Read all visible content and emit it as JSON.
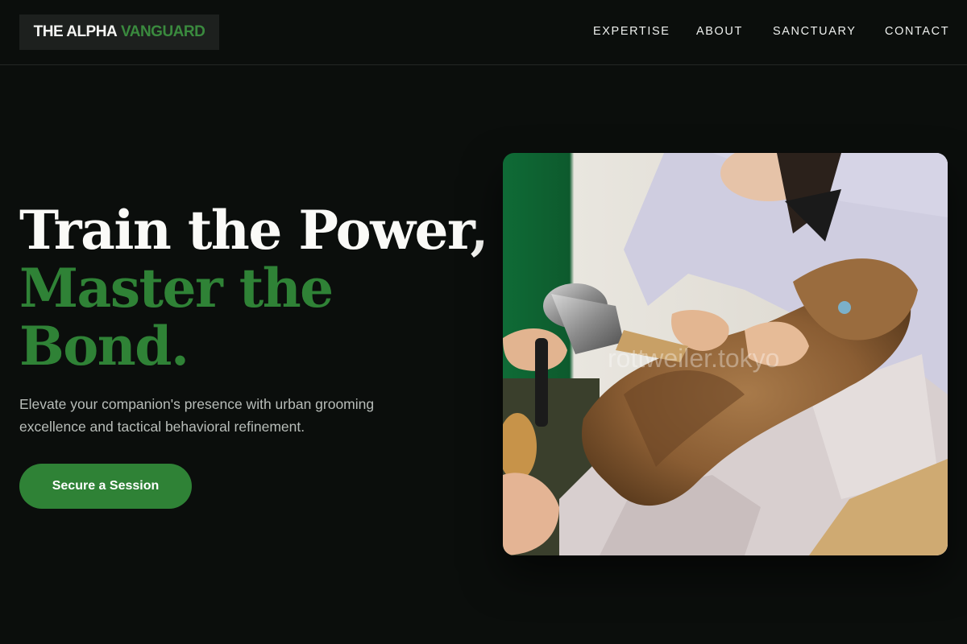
{
  "brand": {
    "name_part1": "THE ALPHA",
    "name_part2": "VANGUARD"
  },
  "nav": {
    "items": [
      {
        "label": "EXPERTISE"
      },
      {
        "label": "ABOUT"
      },
      {
        "label": "SANCTUARY"
      },
      {
        "label": "CONTACT"
      }
    ]
  },
  "hero": {
    "title_line1": "Train the Power,",
    "title_line2": "Master the",
    "title_line3": "Bond.",
    "subtitle": "Elevate your companion's presence with urban grooming excellence and tactical behavioral refinement.",
    "cta_label": "Secure a Session",
    "image_watermark": "rottweiler.tokyo"
  },
  "colors": {
    "background": "#0b0e0c",
    "accent_green": "#2f8236",
    "text_light": "#f5f5f3",
    "text_muted": "#b8bdb9",
    "logo_bg": "#1d201e"
  }
}
